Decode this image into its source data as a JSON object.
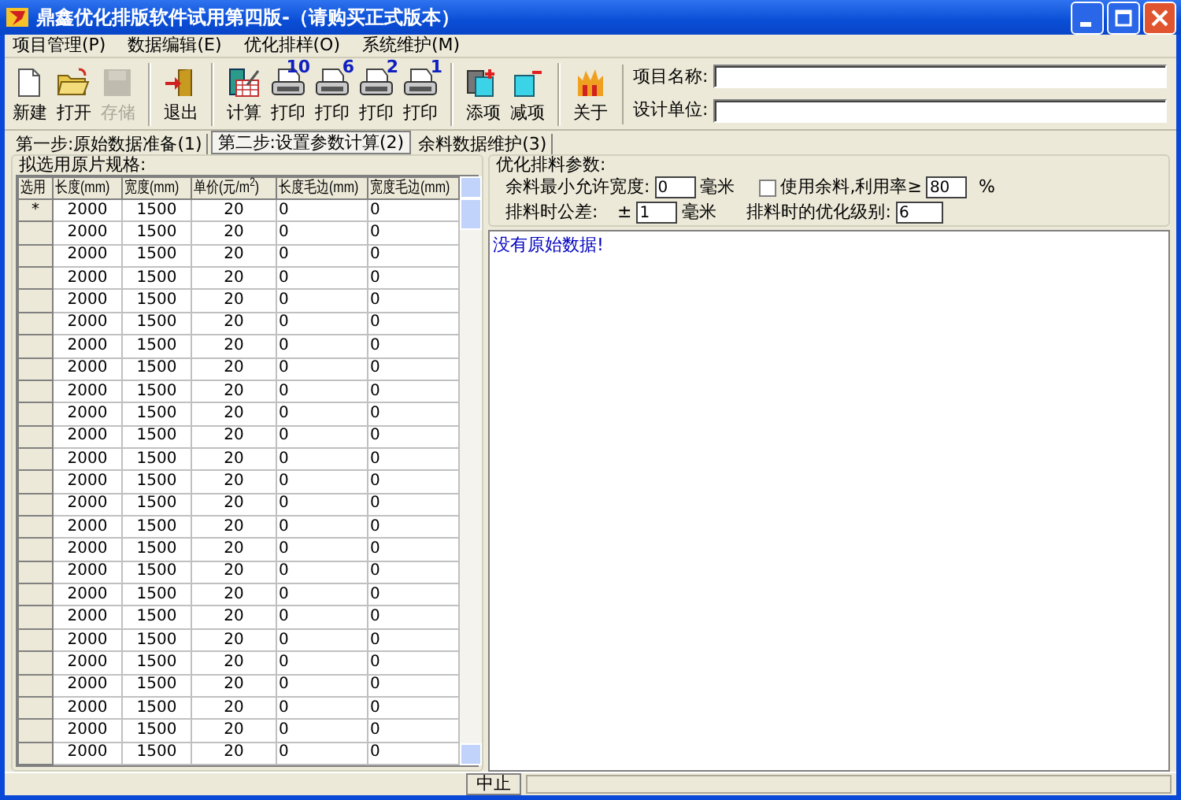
{
  "window": {
    "title": "鼎鑫优化排版软件试用第四版-（请购买正式版本）"
  },
  "menu": [
    "项目管理(P)",
    "数据编辑(E)",
    "优化排样(O)",
    "系统维护(M)"
  ],
  "toolbar": [
    {
      "kind": "new",
      "label": "新建",
      "disabled": false
    },
    {
      "kind": "open",
      "label": "打开",
      "disabled": false
    },
    {
      "kind": "save",
      "label": "存储",
      "disabled": true
    },
    {
      "kind": "exit",
      "label": "退出",
      "disabled": false,
      "separator_before": true
    },
    {
      "kind": "calc",
      "label": "计算",
      "disabled": false,
      "separator_before": true
    },
    {
      "kind": "print",
      "label": "打印",
      "badge": "10",
      "disabled": false
    },
    {
      "kind": "print",
      "label": "打印",
      "badge": "6",
      "disabled": false
    },
    {
      "kind": "print",
      "label": "打印",
      "badge": "2",
      "disabled": false
    },
    {
      "kind": "print",
      "label": "打印",
      "badge": "1",
      "disabled": false
    },
    {
      "kind": "add",
      "label": "添项",
      "disabled": false,
      "separator_before": true
    },
    {
      "kind": "remove",
      "label": "减项",
      "disabled": false
    },
    {
      "kind": "about",
      "label": "关于",
      "disabled": false,
      "separator_before": true
    }
  ],
  "project_fields": [
    {
      "label": "项目名称:"
    },
    {
      "label": "设计单位:"
    }
  ],
  "tabs": [
    {
      "label": "第一步:原始数据准备(1)",
      "selected": false
    },
    {
      "label": "第二步:设置参数计算(2)",
      "selected": true
    },
    {
      "label": "余料数据维护(3)",
      "selected": false
    }
  ],
  "sheet_specs": {
    "title": "拟选用原片规格:",
    "columns": [
      "选用",
      "长度(mm)",
      "宽度(mm)",
      "单价(元/m$^{2}$)",
      "长度毛边(mm)",
      "宽度毛边(mm)"
    ],
    "rows": [
      [
        "*",
        "2000",
        "1500",
        "20",
        "0",
        "0"
      ],
      [
        "",
        "2000",
        "1500",
        "20",
        "0",
        "0"
      ],
      [
        "",
        "2000",
        "1500",
        "20",
        "0",
        "0"
      ],
      [
        "",
        "2000",
        "1500",
        "20",
        "0",
        "0"
      ],
      [
        "",
        "2000",
        "1500",
        "20",
        "0",
        "0"
      ],
      [
        "",
        "2000",
        "1500",
        "20",
        "0",
        "0"
      ],
      [
        "",
        "2000",
        "1500",
        "20",
        "0",
        "0"
      ],
      [
        "",
        "2000",
        "1500",
        "20",
        "0",
        "0"
      ],
      [
        "",
        "2000",
        "1500",
        "20",
        "0",
        "0"
      ],
      [
        "",
        "2000",
        "1500",
        "20",
        "0",
        "0"
      ],
      [
        "",
        "2000",
        "1500",
        "20",
        "0",
        "0"
      ],
      [
        "",
        "2000",
        "1500",
        "20",
        "0",
        "0"
      ],
      [
        "",
        "2000",
        "1500",
        "20",
        "0",
        "0"
      ],
      [
        "",
        "2000",
        "1500",
        "20",
        "0",
        "0"
      ],
      [
        "",
        "2000",
        "1500",
        "20",
        "0",
        "0"
      ],
      [
        "",
        "2000",
        "1500",
        "20",
        "0",
        "0"
      ],
      [
        "",
        "2000",
        "1500",
        "20",
        "0",
        "0"
      ],
      [
        "",
        "2000",
        "1500",
        "20",
        "0",
        "0"
      ],
      [
        "",
        "2000",
        "1500",
        "20",
        "0",
        "0"
      ],
      [
        "",
        "2000",
        "1500",
        "20",
        "0",
        "0"
      ],
      [
        "",
        "2000",
        "1500",
        "20",
        "0",
        "0"
      ],
      [
        "",
        "2000",
        "1500",
        "20",
        "0",
        "0"
      ],
      [
        "",
        "2000",
        "1500",
        "20",
        "0",
        "0"
      ],
      [
        "",
        "2000",
        "1500",
        "20",
        "0",
        "0"
      ],
      [
        "",
        "2000",
        "1500",
        "20",
        "0",
        "0"
      ]
    ]
  },
  "params": {
    "title": "优化排料参数:",
    "min_width": {
      "label": "余料最小允许宽度:",
      "value": "0",
      "unit": "毫米"
    },
    "use_remnant": {
      "label": "使用余料,利用率≥",
      "checked": false,
      "value": "80",
      "unit": "%"
    },
    "tolerance": {
      "label": "排料时公差:",
      "prefix": "±",
      "value": "1",
      "unit": "毫米"
    },
    "level": {
      "label": "排料时的优化级别:",
      "value": "6"
    }
  },
  "output": {
    "text": "没有原始数据!"
  },
  "status_bar": {
    "button": "中止"
  }
}
